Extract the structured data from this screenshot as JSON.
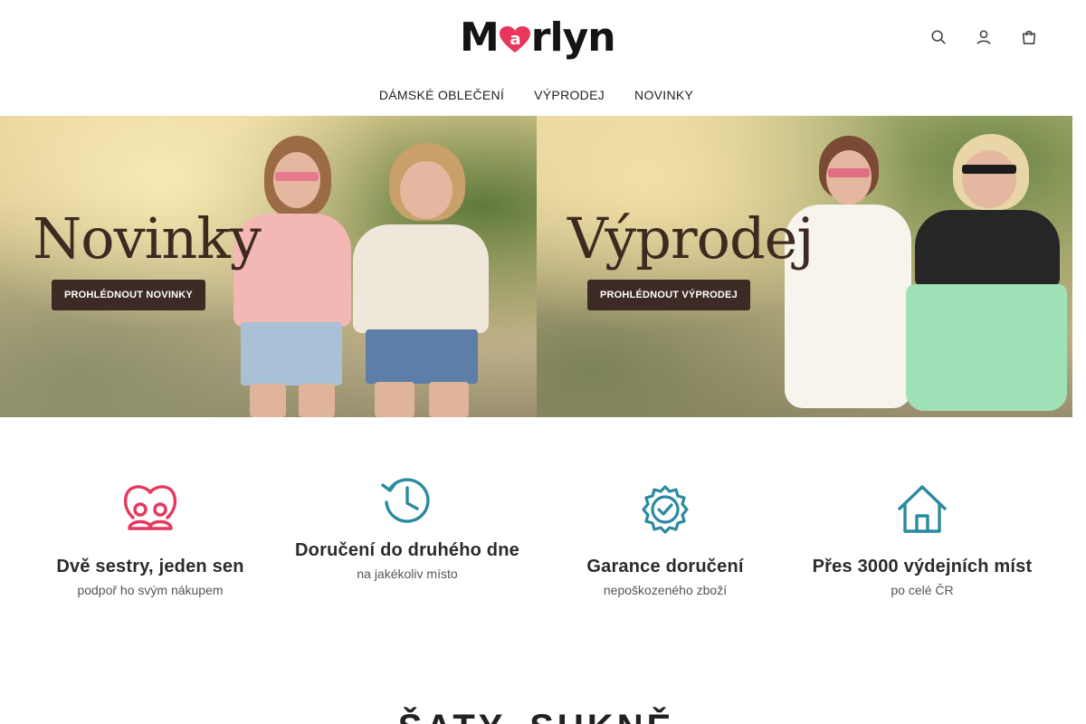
{
  "brand": {
    "logo_prefix": "M",
    "logo_heart_letter": "a",
    "logo_suffix": "rlyn",
    "accent_color": "#e8365d"
  },
  "header": {
    "icons": [
      {
        "name": "search-icon"
      },
      {
        "name": "user-icon"
      },
      {
        "name": "cart-icon"
      }
    ]
  },
  "nav": {
    "items": [
      {
        "label": "DÁMSKÉ OBLEČENÍ"
      },
      {
        "label": "VÝPRODEJ"
      },
      {
        "label": "NOVINKY"
      }
    ]
  },
  "banners": [
    {
      "title": "Novinky",
      "button": "PROHLÉDNOUT NOVINKY"
    },
    {
      "title": "Výprodej",
      "button": "PROHLÉDNOUT VÝPRODEJ"
    }
  ],
  "features": [
    {
      "icon": "heart-people-icon",
      "title": "Dvě sestry, jeden sen",
      "subtitle": "podpoř ho svým nákupem"
    },
    {
      "icon": "history-clock-icon",
      "title": "Doručení do druhého dne",
      "subtitle": "na jakékoliv místo"
    },
    {
      "icon": "badge-check-icon",
      "title": "Garance doručení",
      "subtitle": "nepoškozeného zboží"
    },
    {
      "icon": "home-icon",
      "title": "Přes 3000 výdejních míst",
      "subtitle": "po celé ČR"
    }
  ],
  "section": {
    "heading": "ŠATY, SUKNĚ"
  },
  "colors": {
    "icon_pink": "#e8365d",
    "icon_teal": "#2a8aa0",
    "banner_button": "#3e2a24",
    "banner_title": "#3e2a20"
  }
}
